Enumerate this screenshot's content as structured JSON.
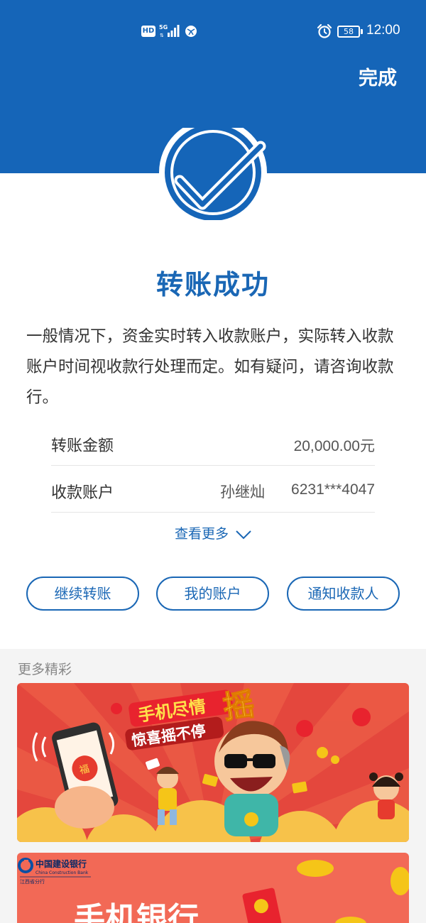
{
  "status_bar": {
    "hd": "HD",
    "network": "5G",
    "battery": "58",
    "time": "12:00"
  },
  "header": {
    "done_label": "完成",
    "color": "#1565b8"
  },
  "result": {
    "title": "转账成功",
    "description": "一般情况下，资金实时转入收款账户，实际转入收款账户时间视收款行处理而定。如有疑问，请咨询收款行。"
  },
  "details": {
    "amount_label": "转账金额",
    "amount_value": "20,000.00元",
    "account_label": "收款账户",
    "payee_name": "孙继灿",
    "account_number": "6231***4047",
    "more_label": "查看更多"
  },
  "actions": {
    "continue_label": "继续转账",
    "my_account_label": "我的账户",
    "notify_label": "通知收款人"
  },
  "promo": {
    "section_title": "更多精彩",
    "banner1_line1": "手机尽情",
    "banner1_big": "摇",
    "banner1_line2": "惊喜摇不停",
    "banner2_bank_cn": "中国建设银行",
    "banner2_bank_en": "China Construction Bank",
    "banner2_branch": "江西省分行",
    "banner2_title": "手机银行"
  }
}
